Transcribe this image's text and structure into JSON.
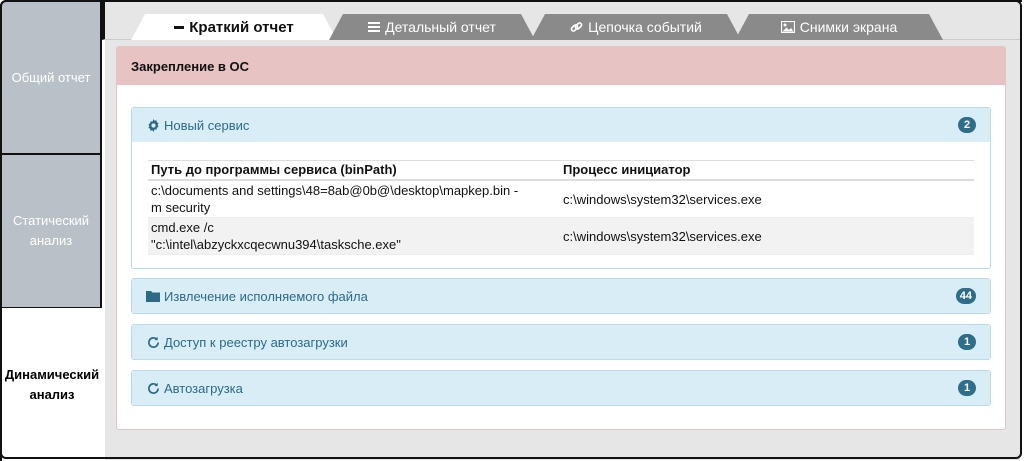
{
  "sidebar": {
    "items": [
      {
        "label": "Общий отчет"
      },
      {
        "label": "Статический анализ"
      },
      {
        "label": "Динамический анализ"
      }
    ]
  },
  "tabs": [
    {
      "label": "Краткий отчет",
      "icon": "minus-icon"
    },
    {
      "label": "Детальный отчет",
      "icon": "list-icon"
    },
    {
      "label": "Цепочка событий",
      "icon": "link-icon"
    },
    {
      "label": "Снимки экрана",
      "icon": "image-icon"
    }
  ],
  "panel": {
    "title": "Закрепление в ОС"
  },
  "sections": [
    {
      "title": "Новый сервис",
      "icon": "gear-icon",
      "count": "2",
      "table": {
        "columns": [
          "Путь до программы сервиса (binPath)",
          "Процесс инициатор"
        ],
        "rows": [
          [
            "c:\\documents and settings\\48=8ab@0b@\\desktop\\mapkep.bin -m security",
            "c:\\windows\\system32\\services.exe"
          ],
          [
            "cmd.exe /c \"c:\\intel\\abzyckxcqecwnu394\\tasksche.exe\"",
            "c:\\windows\\system32\\services.exe"
          ]
        ]
      }
    },
    {
      "title": "Извлечение исполняемого файла",
      "icon": "folder-icon",
      "count": "44"
    },
    {
      "title": "Доступ к реестру автозагрузки",
      "icon": "refresh-icon",
      "count": "1"
    },
    {
      "title": "Автозагрузка",
      "icon": "refresh-icon",
      "count": "1"
    }
  ],
  "colors": {
    "panel_header": "#e7c3c3",
    "section_header": "#d9edf6",
    "section_text": "#2d6a86",
    "badge": "#2f6e8a",
    "sidebar_inactive": "#b9c0c8",
    "tab_inactive": "#8a8a8a"
  }
}
